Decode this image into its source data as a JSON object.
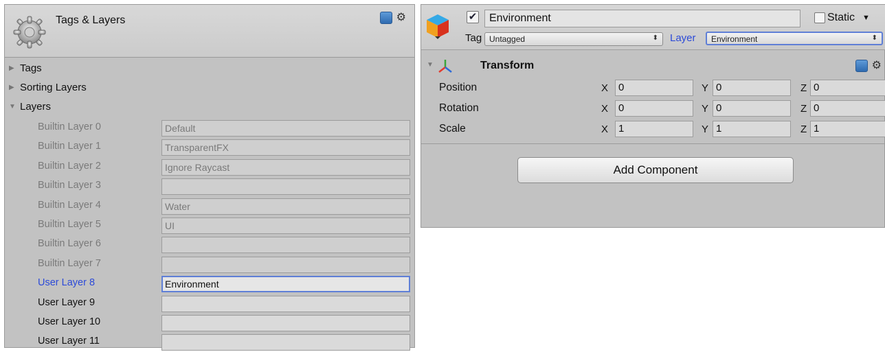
{
  "tags_layers": {
    "title": "Tags & Layers",
    "foldouts": [
      {
        "label": "Tags",
        "expanded": false
      },
      {
        "label": "Sorting Layers",
        "expanded": false
      },
      {
        "label": "Layers",
        "expanded": true
      }
    ],
    "layers": [
      {
        "label": "Builtin Layer 0",
        "value": "Default",
        "kind": "builtin"
      },
      {
        "label": "Builtin Layer 1",
        "value": "TransparentFX",
        "kind": "builtin"
      },
      {
        "label": "Builtin Layer 2",
        "value": "Ignore Raycast",
        "kind": "builtin"
      },
      {
        "label": "Builtin Layer 3",
        "value": "",
        "kind": "builtin"
      },
      {
        "label": "Builtin Layer 4",
        "value": "Water",
        "kind": "builtin"
      },
      {
        "label": "Builtin Layer 5",
        "value": "UI",
        "kind": "builtin"
      },
      {
        "label": "Builtin Layer 6",
        "value": "",
        "kind": "builtin"
      },
      {
        "label": "Builtin Layer 7",
        "value": "",
        "kind": "builtin"
      },
      {
        "label": "User Layer 8",
        "value": "Environment",
        "kind": "active"
      },
      {
        "label": "User Layer 9",
        "value": "",
        "kind": "user"
      },
      {
        "label": "User Layer 10",
        "value": "",
        "kind": "user"
      },
      {
        "label": "User Layer 11",
        "value": "",
        "kind": "user"
      }
    ]
  },
  "inspector": {
    "object_name": "Environment",
    "active_checked": true,
    "static_label": "Static",
    "static_checked": false,
    "tag_label": "Tag",
    "tag_value": "Untagged",
    "layer_label": "Layer",
    "layer_value": "Environment",
    "transform": {
      "title": "Transform",
      "rows": [
        {
          "label": "Position",
          "x": "0",
          "y": "0",
          "z": "0"
        },
        {
          "label": "Rotation",
          "x": "0",
          "y": "0",
          "z": "0"
        },
        {
          "label": "Scale",
          "x": "1",
          "y": "1",
          "z": "1"
        }
      ]
    },
    "add_component_label": "Add Component"
  },
  "icons": {
    "settings": "gear-icon",
    "help": "help-icon",
    "cog": "cog-icon",
    "gameobject": "cube-icon",
    "transform": "axis-icon"
  },
  "colors": {
    "panel_bg": "#c2c2c2",
    "active_blue": "#2c4ad8",
    "focus_border": "#5f7fd6"
  }
}
